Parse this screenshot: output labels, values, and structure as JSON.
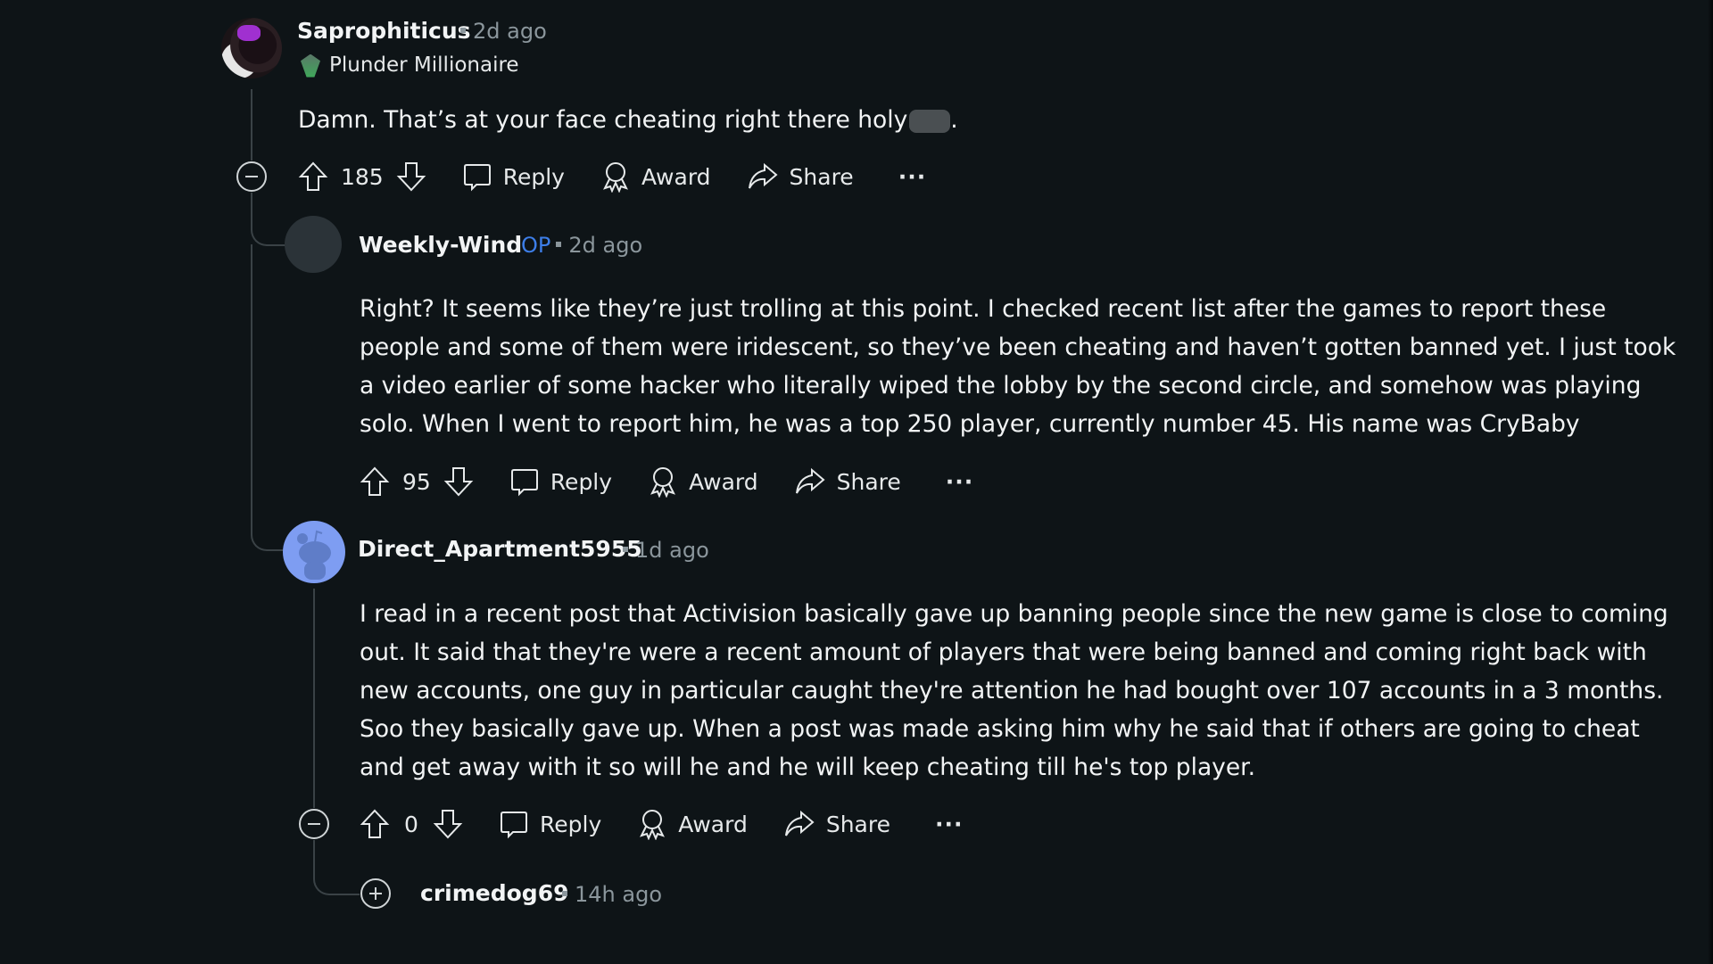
{
  "comments": [
    {
      "username": "Saprophiticus",
      "timestamp": "2d ago",
      "flair": "Plunder Millionaire",
      "body": "Damn. That’s at your face cheating right there holy",
      "body_suffix": ".",
      "votes": "185",
      "actions": {
        "reply": "Reply",
        "award": "Award",
        "share": "Share",
        "more": "···"
      }
    },
    {
      "username": "Weekly-Wind",
      "op_badge": "OP",
      "timestamp": "2d ago",
      "body": "Right? It seems like they’re just trolling at this point. I checked recent list after the games to report these people and some of them were iridescent, so they’ve been cheating and haven’t gotten banned yet. I just took a video earlier of some hacker who literally wiped the lobby by the second circle, and somehow was playing solo. When I went to report him, he was a top 250 player, currently number 45. His name was CryBaby",
      "votes": "95",
      "actions": {
        "reply": "Reply",
        "award": "Award",
        "share": "Share",
        "more": "···"
      }
    },
    {
      "username": "Direct_Apartment5955",
      "timestamp": "1d ago",
      "body": "I read in a recent post that Activision basically gave up banning people since the new game is close to coming out. It said that they're were a recent amount of players that were being banned and coming right back with new accounts, one guy in particular caught they're attention he had bought over 107 accounts in a 3 months. Soo they basically gave up. When a post was made asking him why he said that if others are going to cheat and get away with it so will he and he will keep cheating till he's top player.",
      "votes": "0",
      "actions": {
        "reply": "Reply",
        "award": "Award",
        "share": "Share",
        "more": "···"
      }
    },
    {
      "username": "crimedog69",
      "timestamp": "14h ago",
      "collapsed": true
    }
  ],
  "colors": {
    "background": "#0e1417",
    "op": "#3d7ee8",
    "meta": "#8b969c"
  }
}
